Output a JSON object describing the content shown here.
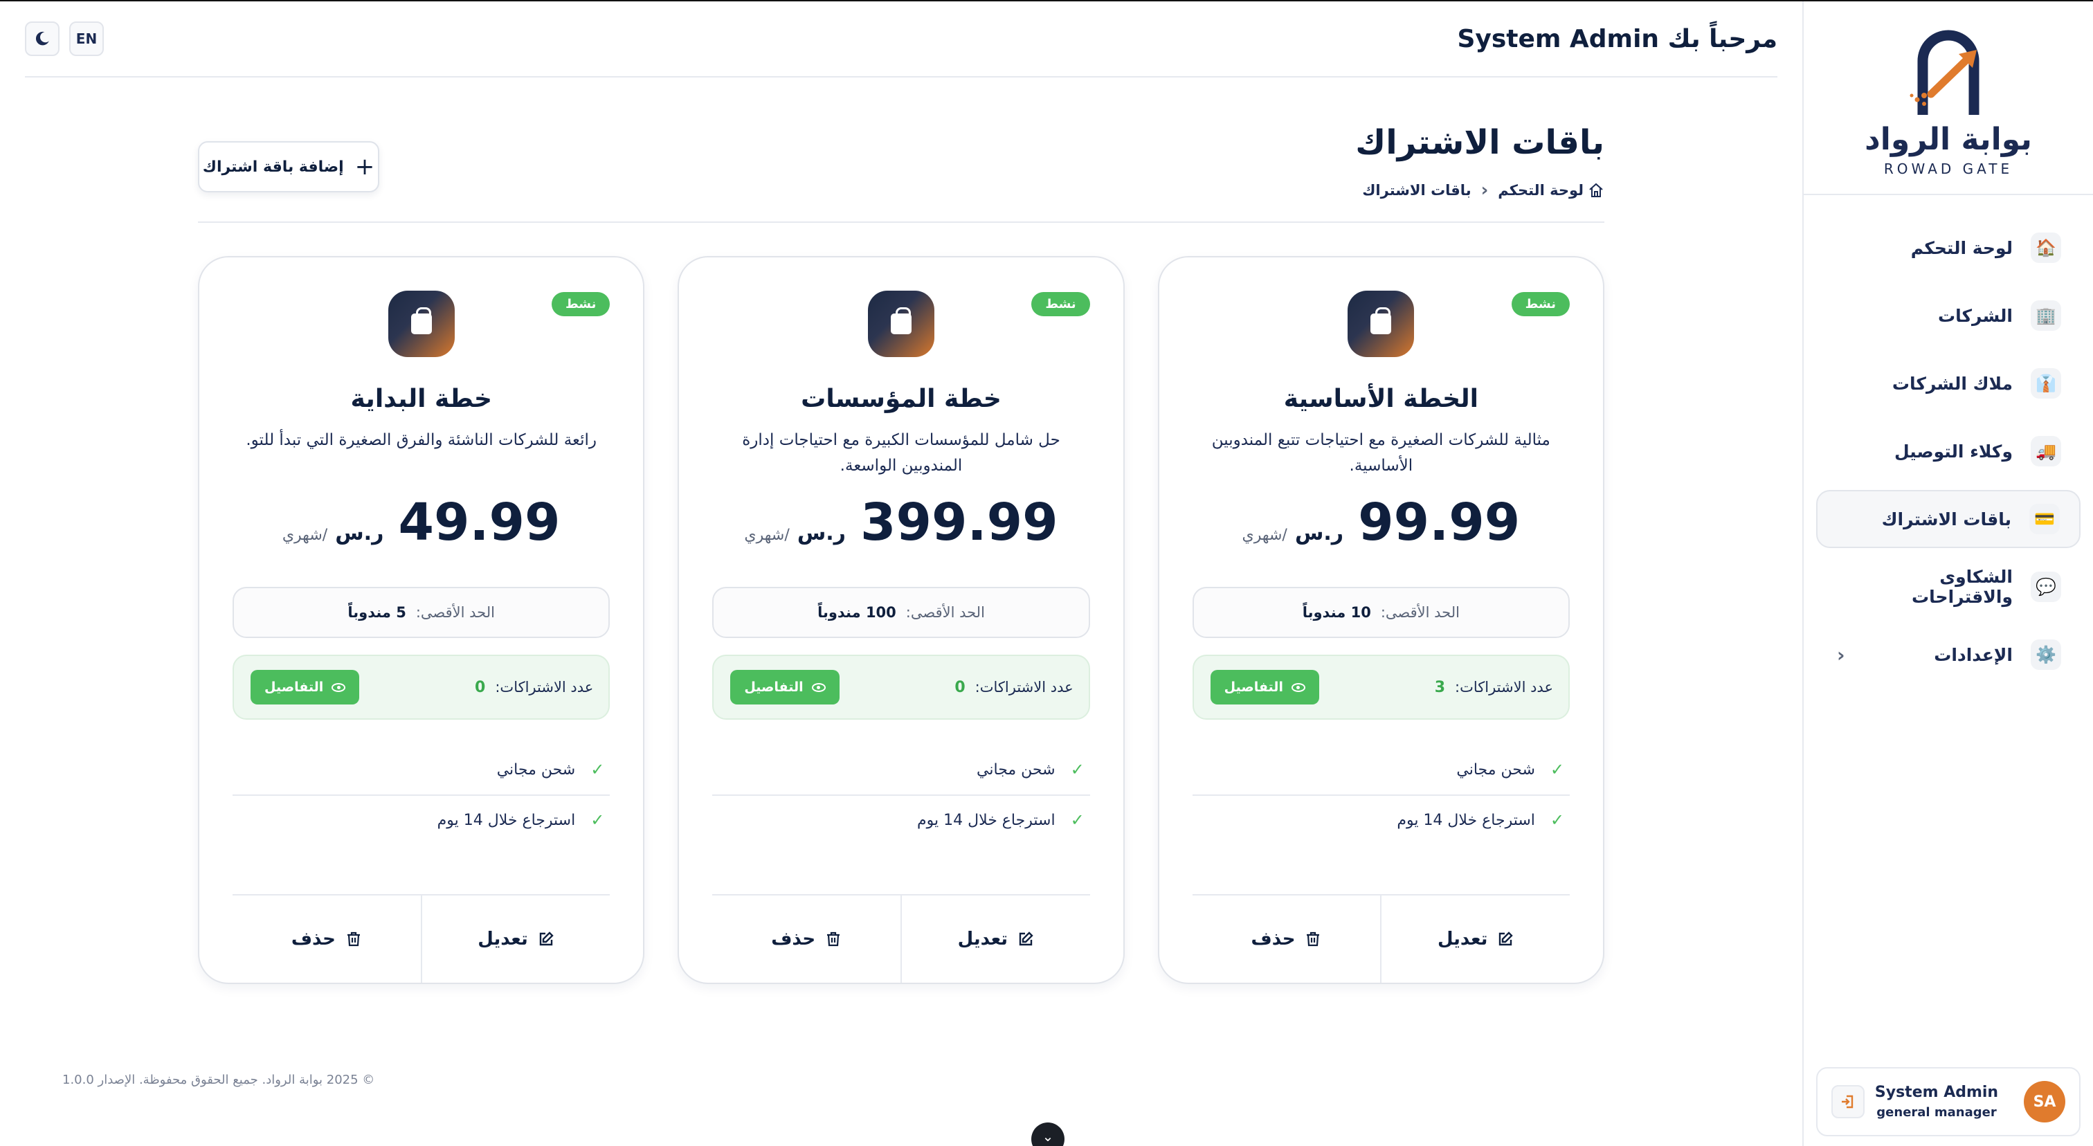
{
  "topbar": {
    "welcome": "مرحباً بك System Admin",
    "lang_btn": "EN",
    "theme_icon": "moon-icon"
  },
  "sidebar": {
    "logo_ar": "بوابة الرواد",
    "logo_en": "ROWAD GATE",
    "items": [
      {
        "label": "لوحة التحكم",
        "icon": "🏠"
      },
      {
        "label": "الشركات",
        "icon": "🏢"
      },
      {
        "label": "ملاك الشركات",
        "icon": "👔"
      },
      {
        "label": "وكلاء التوصيل",
        "icon": "🚚"
      },
      {
        "label": "باقات الاشتراك",
        "icon": "💳"
      },
      {
        "label": "الشكاوى والاقتراحات",
        "icon": "💬"
      },
      {
        "label": "الإعدادات",
        "icon": "⚙️"
      }
    ],
    "active_index": 4,
    "user": {
      "initials": "SA",
      "name": "System Admin",
      "role": "general manager"
    }
  },
  "page": {
    "title": "باقات الاشتراك",
    "breadcrumb_home": "لوحة التحكم",
    "breadcrumb_current": "باقات الاشتراك",
    "add_button": "إضافة باقة اشتراك"
  },
  "card_labels": {
    "status": "نشط",
    "currency": "ر.س",
    "period": "/شهري",
    "limit_label": "الحد الأقصى:",
    "subs_label": "عدد الاشتراكات:",
    "details": "التفاصيل",
    "edit": "تعديل",
    "delete": "حذف"
  },
  "plans": [
    {
      "name": "الخطة الأساسية",
      "description": "مثالية للشركات الصغيرة مع احتياجات تتبع المندوبين الأساسية.",
      "price": "99.99",
      "limit": "10 مندوباً",
      "subscriptions": "3",
      "features": [
        "شحن مجاني",
        "استرجاع خلال 14 يوم"
      ]
    },
    {
      "name": "خطة المؤسسات",
      "description": "حل شامل للمؤسسات الكبيرة مع احتياجات إدارة المندوبين الواسعة.",
      "price": "399.99",
      "limit": "100 مندوباً",
      "subscriptions": "0",
      "features": [
        "شحن مجاني",
        "استرجاع خلال 14 يوم"
      ]
    },
    {
      "name": "خطة البداية",
      "description": "رائعة للشركات الناشئة والفرق الصغيرة التي تبدأ للتو.",
      "price": "49.99",
      "limit": "5 مندوباً",
      "subscriptions": "0",
      "features": [
        "شحن مجاني",
        "استرجاع خلال 14 يوم"
      ]
    }
  ],
  "footer": {
    "text": "© 2025 بوابة الرواد. جميع الحقوق محفوظة. الإصدار 1.0.0"
  },
  "colors": {
    "primary": "#0f1f3d",
    "accent": "#e07b2d",
    "success": "#4cbd5d"
  }
}
